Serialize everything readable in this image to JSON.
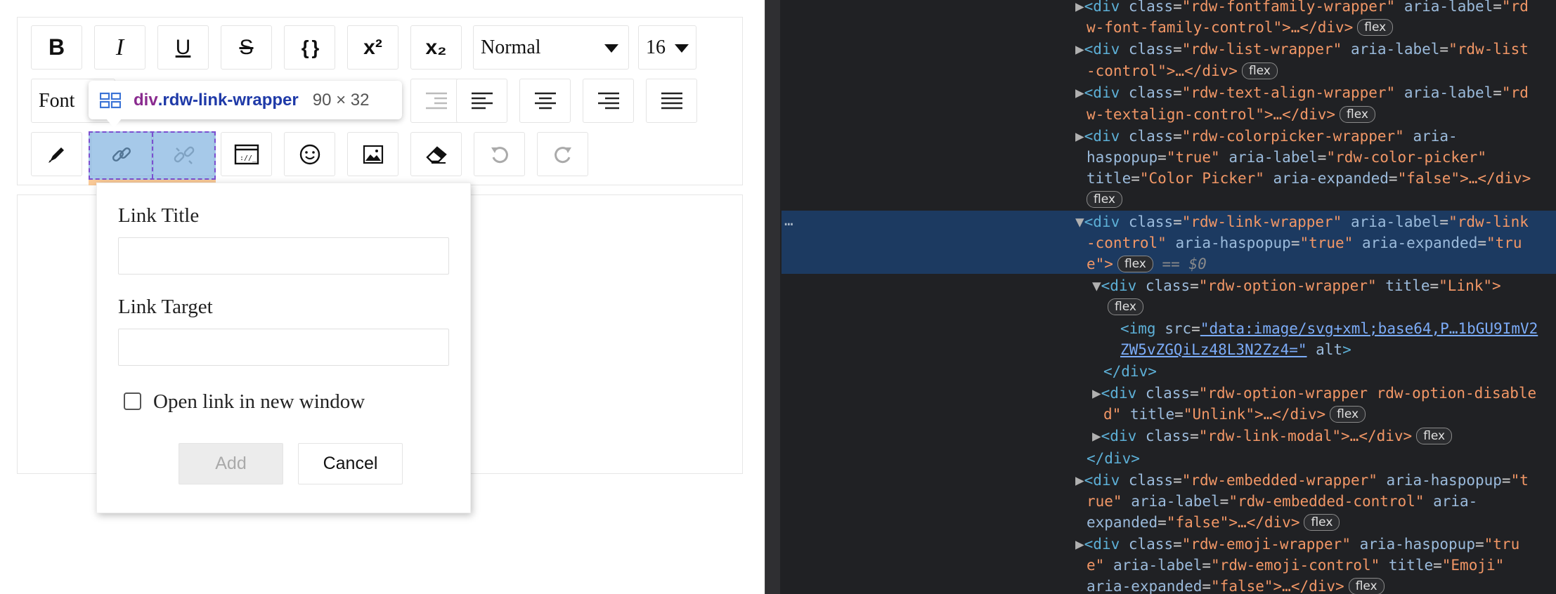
{
  "toolbar": {
    "row1": {
      "bold_label": "B",
      "italic_label": "I",
      "underline_label": "U",
      "strike_label": "S",
      "code_label": "{ }",
      "superscript_label": "x²",
      "subscript_label": "x₂",
      "block_type": "Normal",
      "font_size": "16"
    },
    "row2": {
      "font_family": "Font"
    }
  },
  "inspect_tooltip": {
    "tag": "div",
    "class_name": ".rdw-link-wrapper",
    "size": "90 × 32"
  },
  "link_modal": {
    "title_label": "Link Title",
    "title_value": "",
    "target_label": "Link Target",
    "target_value": "",
    "new_window_label": "Open link in new window",
    "new_window_checked": false,
    "add_label": "Add",
    "cancel_label": "Cancel"
  },
  "devtools": {
    "selected_marker": "== $0",
    "dots": "…",
    "badge": "flex",
    "lines": [
      {
        "t1": "<div ",
        "a1": "class",
        "v1": "\"rdw-fontfamily-wrapper\"",
        "a2": " aria-label",
        "v2": "\"rd"
      },
      {
        "cont": "w-font-family-control\">…</div>"
      },
      {
        "t1": "<div ",
        "a1": "class",
        "v1": "\"rdw-list-wrapper\"",
        "a2": " aria-label",
        "v2": "\"rdw-list"
      },
      {
        "cont": "-control\">…</div>"
      },
      {
        "t1": "<div ",
        "a1": "class",
        "v1": "\"rdw-text-align-wrapper\"",
        "a2": " aria-label",
        "v2": "\"rd"
      },
      {
        "cont": "w-textalign-control\">…</div>"
      },
      {
        "t1": "<div ",
        "a1": "class",
        "v1": "\"rdw-colorpicker-wrapper\"",
        "a2": " aria-",
        "v2": ""
      },
      {
        "cont2a": "haspopup",
        "cont2b": "\"true\"",
        "cont2c": " aria-label",
        "cont2d": "\"rdw-color-picker\""
      },
      {
        "cont3a": "title",
        "cont3b": "\"Color Picker\"",
        "cont3c": " aria-expanded",
        "cont3d": "\"false\">…</div>"
      },
      {
        "t1": "<div ",
        "a1": "class",
        "v1": "\"rdw-link-wrapper\"",
        "a2": " aria-label",
        "v2": "\"rdw-link"
      },
      {
        "cont2a": "-control\"",
        "cont2b": " aria-haspopup",
        "cont2c": "\"true\"",
        "cont2d": " aria-expanded",
        "cont2e": "\"tru"
      },
      {
        "cont": "e\">"
      },
      {
        "t1": "<div ",
        "a1": "class",
        "v1": "\"rdw-option-wrapper\"",
        "a2": " title",
        "v2": "\"Link\">"
      },
      {
        "t1": "<img ",
        "a1": "src",
        "v1": "\"data:image/svg+xml;base64,P…1bGU9ImV2"
      },
      {
        "cont": "ZW5vZGQiLz48L3N2Zz4=\"",
        "a2": " alt",
        "v2": ">"
      },
      {
        "t1": "</div>"
      },
      {
        "t1": "<div ",
        "a1": "class",
        "v1": "\"rdw-option-wrapper rdw-option-disable"
      },
      {
        "cont": "d\"",
        "a2": " title",
        "v2": "\"Unlink\">…</div>"
      },
      {
        "t1": "<div ",
        "a1": "class",
        "v1": "\"rdw-link-modal\">…</div>"
      },
      {
        "t1": "</div>"
      },
      {
        "t1": "<div ",
        "a1": "class",
        "v1": "\"rdw-embedded-wrapper\"",
        "a2": " aria-haspopup",
        "v2": "\"t"
      },
      {
        "cont": "rue\"",
        "a2": " aria-label",
        "v2": "\"rdw-embedded-control\"",
        "a3": " aria-"
      },
      {
        "cont2a": "expanded",
        "cont2b": "\"false\">…</div>"
      },
      {
        "t1": "<div ",
        "a1": "class",
        "v1": "\"rdw-emoji-wrapper\"",
        "a2": " aria-haspopup",
        "v2": "\"tru"
      },
      {
        "cont": "e\"",
        "a2": " aria-label",
        "v2": "\"rdw-emoji-control\"",
        "a3": " title",
        "v3": "\"Emoji\""
      },
      {
        "cont2a": "aria-expanded",
        "cont2b": "\"false\">…</div>"
      }
    ]
  }
}
